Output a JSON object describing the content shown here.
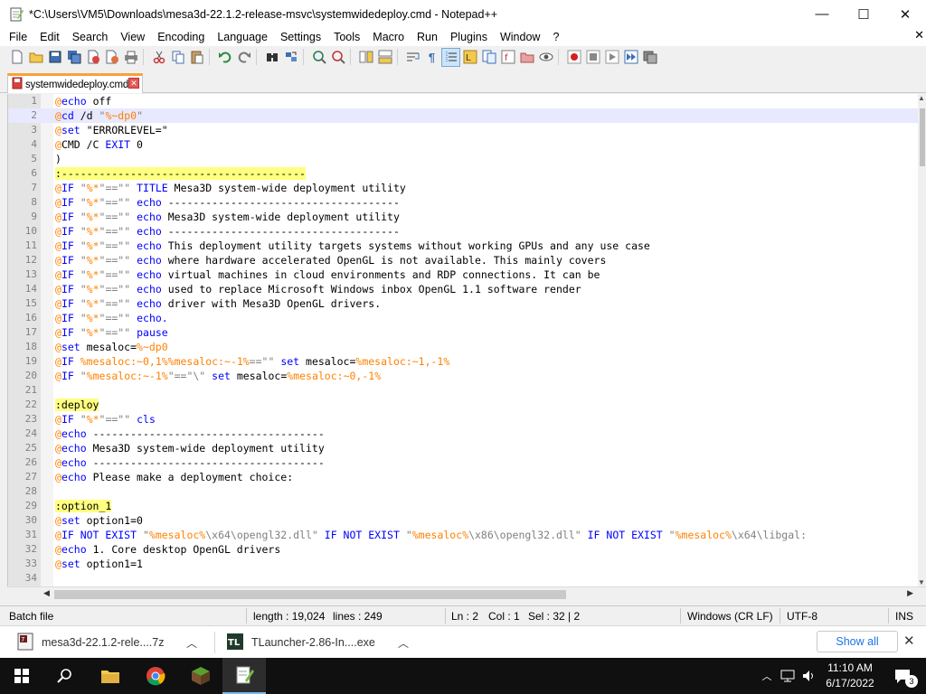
{
  "window": {
    "title": "*C:\\Users\\VM5\\Downloads\\mesa3d-22.1.2-release-msvc\\systemwidedeploy.cmd - Notepad++",
    "minimize_glyph": "—",
    "maximize_glyph": "☐",
    "close_glyph": "✕"
  },
  "menu": {
    "items": [
      "File",
      "Edit",
      "Search",
      "View",
      "Encoding",
      "Language",
      "Settings",
      "Tools",
      "Macro",
      "Run",
      "Plugins",
      "Window",
      "?"
    ],
    "close_glyph": "✕"
  },
  "tab": {
    "label": "systemwidedeploy.cmd",
    "close_glyph": "✕"
  },
  "editor": {
    "current_line": 2,
    "colors": {
      "keyword": "#0000ff",
      "at": "#ff8000",
      "label_bg": "#ffff80",
      "string": "#808080",
      "variable": "#ff8000",
      "plain": "#000000"
    },
    "lines": [
      {
        "n": "1",
        "tokens": [
          [
            "at",
            "@"
          ],
          [
            "k",
            "echo"
          ],
          [
            "t",
            " off"
          ]
        ]
      },
      {
        "n": "2",
        "tokens": [
          [
            "at",
            "@"
          ],
          [
            "k",
            "cd"
          ],
          [
            "t",
            " /d "
          ],
          [
            "s",
            "\""
          ],
          [
            "v",
            "%~dp0"
          ],
          [
            "s",
            "\""
          ]
        ]
      },
      {
        "n": "3",
        "tokens": [
          [
            "at",
            "@"
          ],
          [
            "k",
            "set"
          ],
          [
            "t",
            " \"ERRORLEVEL=\""
          ]
        ]
      },
      {
        "n": "4",
        "tokens": [
          [
            "at",
            "@"
          ],
          [
            "t",
            "CMD /C "
          ],
          [
            "k",
            "EXIT"
          ],
          [
            "t",
            " 0"
          ]
        ]
      },
      {
        "n": "5",
        "tokens": [
          [
            "t",
            ")"
          ]
        ]
      },
      {
        "n": "6",
        "tokens": [
          [
            "lbl",
            ":---------------------------------------"
          ]
        ]
      },
      {
        "n": "7",
        "tokens": [
          [
            "at",
            "@"
          ],
          [
            "k",
            "IF"
          ],
          [
            "t",
            " "
          ],
          [
            "s",
            "\""
          ],
          [
            "v",
            "%*"
          ],
          [
            "s",
            "\"==\"\""
          ],
          [
            "t",
            " "
          ],
          [
            "k",
            "TITLE"
          ],
          [
            "t",
            " Mesa3D system-wide deployment utility"
          ]
        ]
      },
      {
        "n": "8",
        "tokens": [
          [
            "at",
            "@"
          ],
          [
            "k",
            "IF"
          ],
          [
            "t",
            " "
          ],
          [
            "s",
            "\""
          ],
          [
            "v",
            "%*"
          ],
          [
            "s",
            "\"==\"\""
          ],
          [
            "t",
            " "
          ],
          [
            "k",
            "echo"
          ],
          [
            "t",
            " -------------------------------------"
          ]
        ]
      },
      {
        "n": "9",
        "tokens": [
          [
            "at",
            "@"
          ],
          [
            "k",
            "IF"
          ],
          [
            "t",
            " "
          ],
          [
            "s",
            "\""
          ],
          [
            "v",
            "%*"
          ],
          [
            "s",
            "\"==\"\""
          ],
          [
            "t",
            " "
          ],
          [
            "k",
            "echo"
          ],
          [
            "t",
            " Mesa3D system-wide deployment utility"
          ]
        ]
      },
      {
        "n": "10",
        "tokens": [
          [
            "at",
            "@"
          ],
          [
            "k",
            "IF"
          ],
          [
            "t",
            " "
          ],
          [
            "s",
            "\""
          ],
          [
            "v",
            "%*"
          ],
          [
            "s",
            "\"==\"\""
          ],
          [
            "t",
            " "
          ],
          [
            "k",
            "echo"
          ],
          [
            "t",
            " -------------------------------------"
          ]
        ]
      },
      {
        "n": "11",
        "tokens": [
          [
            "at",
            "@"
          ],
          [
            "k",
            "IF"
          ],
          [
            "t",
            " "
          ],
          [
            "s",
            "\""
          ],
          [
            "v",
            "%*"
          ],
          [
            "s",
            "\"==\"\""
          ],
          [
            "t",
            " "
          ],
          [
            "k",
            "echo"
          ],
          [
            "t",
            " This deployment utility targets systems without working GPUs and any use case"
          ]
        ]
      },
      {
        "n": "12",
        "tokens": [
          [
            "at",
            "@"
          ],
          [
            "k",
            "IF"
          ],
          [
            "t",
            " "
          ],
          [
            "s",
            "\""
          ],
          [
            "v",
            "%*"
          ],
          [
            "s",
            "\"==\"\""
          ],
          [
            "t",
            " "
          ],
          [
            "k",
            "echo"
          ],
          [
            "t",
            " where hardware accelerated OpenGL is not available. This mainly covers"
          ]
        ]
      },
      {
        "n": "13",
        "tokens": [
          [
            "at",
            "@"
          ],
          [
            "k",
            "IF"
          ],
          [
            "t",
            " "
          ],
          [
            "s",
            "\""
          ],
          [
            "v",
            "%*"
          ],
          [
            "s",
            "\"==\"\""
          ],
          [
            "t",
            " "
          ],
          [
            "k",
            "echo"
          ],
          [
            "t",
            " virtual machines in cloud environments and RDP connections. It can be"
          ]
        ]
      },
      {
        "n": "14",
        "tokens": [
          [
            "at",
            "@"
          ],
          [
            "k",
            "IF"
          ],
          [
            "t",
            " "
          ],
          [
            "s",
            "\""
          ],
          [
            "v",
            "%*"
          ],
          [
            "s",
            "\"==\"\""
          ],
          [
            "t",
            " "
          ],
          [
            "k",
            "echo"
          ],
          [
            "t",
            " used to replace Microsoft Windows inbox OpenGL 1.1 software render"
          ]
        ]
      },
      {
        "n": "15",
        "tokens": [
          [
            "at",
            "@"
          ],
          [
            "k",
            "IF"
          ],
          [
            "t",
            " "
          ],
          [
            "s",
            "\""
          ],
          [
            "v",
            "%*"
          ],
          [
            "s",
            "\"==\"\""
          ],
          [
            "t",
            " "
          ],
          [
            "k",
            "echo"
          ],
          [
            "t",
            " driver with Mesa3D OpenGL drivers."
          ]
        ]
      },
      {
        "n": "16",
        "tokens": [
          [
            "at",
            "@"
          ],
          [
            "k",
            "IF"
          ],
          [
            "t",
            " "
          ],
          [
            "s",
            "\""
          ],
          [
            "v",
            "%*"
          ],
          [
            "s",
            "\"==\"\""
          ],
          [
            "t",
            " "
          ],
          [
            "k",
            "echo."
          ]
        ]
      },
      {
        "n": "17",
        "tokens": [
          [
            "at",
            "@"
          ],
          [
            "k",
            "IF"
          ],
          [
            "t",
            " "
          ],
          [
            "s",
            "\""
          ],
          [
            "v",
            "%*"
          ],
          [
            "s",
            "\"==\"\""
          ],
          [
            "t",
            " "
          ],
          [
            "k",
            "pause"
          ]
        ]
      },
      {
        "n": "18",
        "tokens": [
          [
            "at",
            "@"
          ],
          [
            "k",
            "set"
          ],
          [
            "t",
            " mesaloc="
          ],
          [
            "v",
            "%~dp0"
          ]
        ]
      },
      {
        "n": "19",
        "tokens": [
          [
            "at",
            "@"
          ],
          [
            "k",
            "IF"
          ],
          [
            "t",
            " "
          ],
          [
            "v",
            "%mesaloc:~0,1%%mesaloc:~-1%"
          ],
          [
            "s",
            "==\"\""
          ],
          [
            "t",
            " "
          ],
          [
            "k",
            "set"
          ],
          [
            "t",
            " mesaloc="
          ],
          [
            "v",
            "%mesaloc:~1,-1%"
          ]
        ]
      },
      {
        "n": "20",
        "tokens": [
          [
            "at",
            "@"
          ],
          [
            "k",
            "IF"
          ],
          [
            "t",
            " "
          ],
          [
            "s",
            "\""
          ],
          [
            "v",
            "%mesaloc:~-1%"
          ],
          [
            "s",
            "\"==\"\\\""
          ],
          [
            "t",
            " "
          ],
          [
            "k",
            "set"
          ],
          [
            "t",
            " mesaloc="
          ],
          [
            "v",
            "%mesaloc:~0,-1%"
          ]
        ]
      },
      {
        "n": "21",
        "tokens": []
      },
      {
        "n": "22",
        "tokens": [
          [
            "lbl",
            ":deploy"
          ]
        ]
      },
      {
        "n": "23",
        "tokens": [
          [
            "at",
            "@"
          ],
          [
            "k",
            "IF"
          ],
          [
            "t",
            " "
          ],
          [
            "s",
            "\""
          ],
          [
            "v",
            "%*"
          ],
          [
            "s",
            "\"==\"\""
          ],
          [
            "t",
            " "
          ],
          [
            "k",
            "cls"
          ]
        ]
      },
      {
        "n": "24",
        "tokens": [
          [
            "at",
            "@"
          ],
          [
            "k",
            "echo"
          ],
          [
            "t",
            " -------------------------------------"
          ]
        ]
      },
      {
        "n": "25",
        "tokens": [
          [
            "at",
            "@"
          ],
          [
            "k",
            "echo"
          ],
          [
            "t",
            " Mesa3D system-wide deployment utility"
          ]
        ]
      },
      {
        "n": "26",
        "tokens": [
          [
            "at",
            "@"
          ],
          [
            "k",
            "echo"
          ],
          [
            "t",
            " -------------------------------------"
          ]
        ]
      },
      {
        "n": "27",
        "tokens": [
          [
            "at",
            "@"
          ],
          [
            "k",
            "echo"
          ],
          [
            "t",
            " Please make a deployment choice:"
          ]
        ]
      },
      {
        "n": "28",
        "tokens": []
      },
      {
        "n": "29",
        "tokens": [
          [
            "lbl",
            ":option_1"
          ]
        ]
      },
      {
        "n": "30",
        "tokens": [
          [
            "at",
            "@"
          ],
          [
            "k",
            "set"
          ],
          [
            "t",
            " option1=0"
          ]
        ]
      },
      {
        "n": "31",
        "tokens": [
          [
            "at",
            "@"
          ],
          [
            "k",
            "IF NOT EXIST"
          ],
          [
            "t",
            " "
          ],
          [
            "s",
            "\""
          ],
          [
            "v",
            "%mesaloc%"
          ],
          [
            "s",
            "\\x64\\opengl32.dll\""
          ],
          [
            "t",
            " "
          ],
          [
            "k",
            "IF NOT EXIST"
          ],
          [
            "t",
            " "
          ],
          [
            "s",
            "\""
          ],
          [
            "v",
            "%mesaloc%"
          ],
          [
            "s",
            "\\x86\\opengl32.dll\""
          ],
          [
            "t",
            " "
          ],
          [
            "k",
            "IF NOT EXIST"
          ],
          [
            "t",
            " "
          ],
          [
            "s",
            "\""
          ],
          [
            "v",
            "%mesaloc%"
          ],
          [
            "s",
            "\\x64\\libgal:"
          ]
        ]
      },
      {
        "n": "32",
        "tokens": [
          [
            "at",
            "@"
          ],
          [
            "k",
            "echo"
          ],
          [
            "t",
            " 1. Core desktop OpenGL drivers"
          ]
        ]
      },
      {
        "n": "33",
        "tokens": [
          [
            "at",
            "@"
          ],
          [
            "k",
            "set"
          ],
          [
            "t",
            " option1=1"
          ]
        ]
      },
      {
        "n": "34",
        "tokens": []
      }
    ]
  },
  "status": {
    "filetype": "Batch file",
    "length": "length : 19,024",
    "lines": "lines : 249",
    "ln": "Ln : 2",
    "col": "Col : 1",
    "sel": "Sel : 32 | 2",
    "eol": "Windows (CR LF)",
    "encoding": "UTF-8",
    "mode": "INS"
  },
  "downloads": {
    "items": [
      {
        "name": "mesa3d-22.1.2-rele....7z",
        "icon": "archive-icon"
      },
      {
        "name": "TLauncher-2.86-In....exe",
        "icon": "tlauncher-icon"
      }
    ],
    "show_all": "Show all",
    "close_glyph": "✕"
  },
  "taskbar": {
    "time": "11:10 AM",
    "date": "6/17/2022",
    "notification_count": "3",
    "apps": [
      "start-icon",
      "search-icon",
      "file-explorer-icon",
      "chrome-icon",
      "minecraft-icon",
      "notepadpp-icon"
    ]
  }
}
